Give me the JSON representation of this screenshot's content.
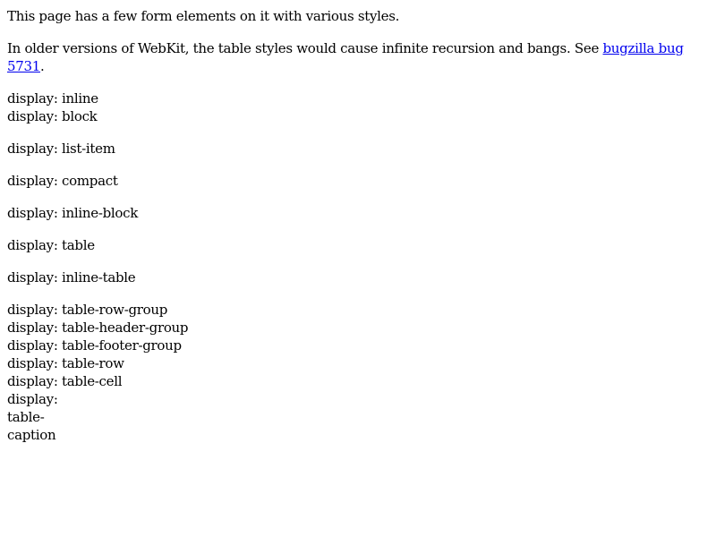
{
  "intro": {
    "text": "This page has a few form elements on it with various styles."
  },
  "note": {
    "text_before": "In older versions of WebKit, the table styles would cause infinite recursion and bangs. See ",
    "link_text": "bugzilla bug 5731",
    "text_after": "."
  },
  "displays": {
    "g1": [
      "display: inline",
      "display: block"
    ],
    "g2": [
      "display: list-item"
    ],
    "g3": [
      "display: compact"
    ],
    "g4": [
      "display: inline-block"
    ],
    "g5": [
      "display: table"
    ],
    "g6": [
      "display: inline-table"
    ],
    "g7": [
      "display: table-row-group",
      "display: table-header-group",
      "display: table-footer-group",
      "display: table-row",
      "display: table-cell"
    ],
    "caption": [
      "display:",
      "table-",
      "caption"
    ]
  },
  "colors": {
    "link": "#0000ee",
    "text": "#000000",
    "background": "#ffffff"
  }
}
